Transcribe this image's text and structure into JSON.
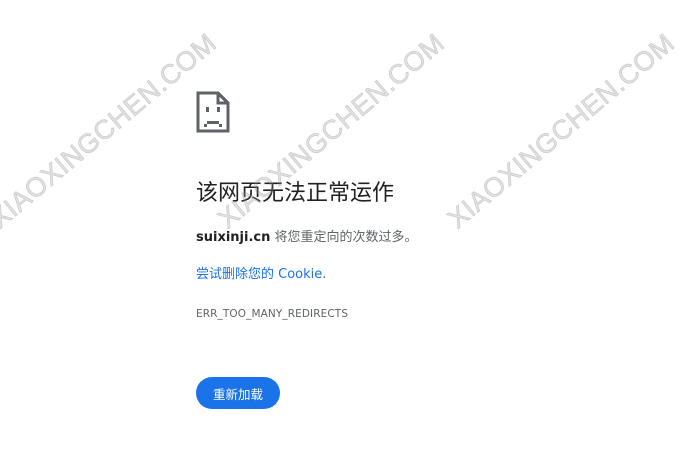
{
  "error": {
    "icon": "sad-page-icon",
    "title": "该网页无法正常运作",
    "host": "suixinji.cn",
    "summary_rest": " 将您重定向的次数过多。",
    "suggestion_link": "尝试删除您的 Cookie",
    "suggestion_period": ".",
    "code": "ERR_TOO_MANY_REDIRECTS"
  },
  "actions": {
    "reload_label": "重新加载"
  },
  "watermark": {
    "text": "XIAOXINGCHEN.COM"
  },
  "colors": {
    "accent": "#1a73e8",
    "title_text": "#202124",
    "body_text": "#5f6368"
  }
}
